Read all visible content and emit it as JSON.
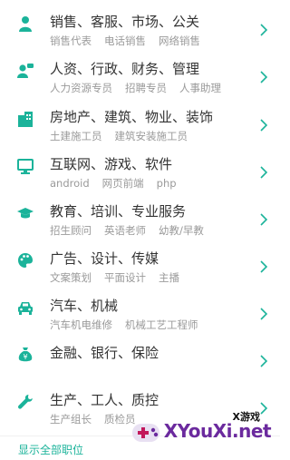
{
  "colors": {
    "accent": "#1bb39a",
    "title": "#333333",
    "sub": "#9a9a9a",
    "chevron": "#1bb39a"
  },
  "categories": [
    {
      "icon": "person-icon",
      "title": "销售、客服、市场、公关",
      "subs": [
        "销售代表",
        "电话销售",
        "网络销售"
      ]
    },
    {
      "icon": "person-chat-icon",
      "title": "人资、行政、财务、管理",
      "subs": [
        "人力资源专员",
        "招聘专员",
        "人事助理"
      ]
    },
    {
      "icon": "building-icon",
      "title": "房地产、建筑、物业、装饰",
      "subs": [
        "土建施工员",
        "建筑安装施工员"
      ]
    },
    {
      "icon": "monitor-icon",
      "title": "互联网、游戏、软件",
      "subs": [
        "android",
        "网页前端",
        "php"
      ]
    },
    {
      "icon": "graduation-cap-icon",
      "title": "教育、培训、专业服务",
      "subs": [
        "招生顾问",
        "英语老师",
        "幼教/早教"
      ]
    },
    {
      "icon": "palette-icon",
      "title": "广告、设计、传媒",
      "subs": [
        "文案策划",
        "平面设计",
        "主播"
      ]
    },
    {
      "icon": "car-icon",
      "title": "汽车、机械",
      "subs": [
        "汽车机电维修",
        "机械工艺工程师"
      ]
    },
    {
      "icon": "money-bag-icon",
      "title": "金融、银行、保险",
      "subs": []
    },
    {
      "icon": "wrench-icon",
      "title": "生产、工人、质控",
      "subs": [
        "生产组长",
        "质检员"
      ]
    }
  ],
  "footer": {
    "show_all": "显示全部职位"
  },
  "watermark": {
    "small": "X游戏",
    "text": "XYouXi.net"
  }
}
